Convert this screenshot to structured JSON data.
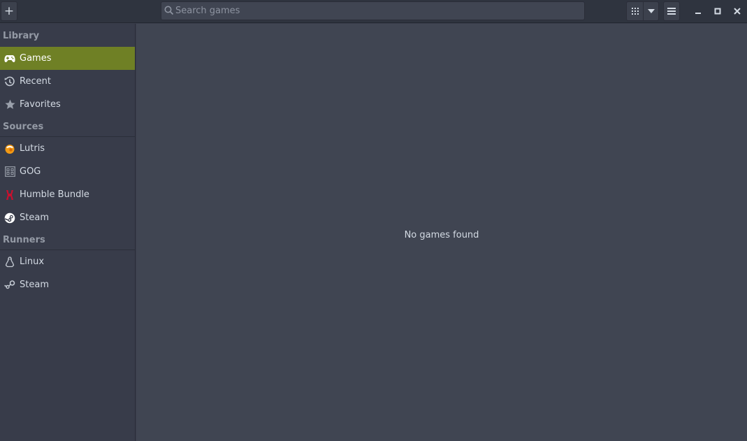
{
  "header": {
    "add_label": "+",
    "search_placeholder": "Search games",
    "search_value": "",
    "icons": {
      "add": "plus-icon",
      "search": "search-icon",
      "view": "grid-view-icon",
      "dropdown": "chevron-down-icon",
      "menu": "hamburger-menu-icon",
      "minimize": "minimize-icon",
      "maximize": "maximize-icon",
      "close": "close-icon"
    }
  },
  "sidebar": {
    "library_title": "Library",
    "library": [
      {
        "label": "Games",
        "icon": "gamepad-icon",
        "active": true
      },
      {
        "label": "Recent",
        "icon": "history-icon"
      },
      {
        "label": "Favorites",
        "icon": "star-icon"
      }
    ],
    "sources_title": "Sources",
    "sources": [
      {
        "label": "Lutris",
        "icon": "lutris-icon"
      },
      {
        "label": "GOG",
        "icon": "gog-icon"
      },
      {
        "label": "Humble Bundle",
        "icon": "humble-bundle-icon"
      },
      {
        "label": "Steam",
        "icon": "steam-icon"
      }
    ],
    "runners_title": "Runners",
    "runners": [
      {
        "label": "Linux",
        "icon": "linux-icon"
      },
      {
        "label": "Steam",
        "icon": "steam-runner-icon"
      }
    ]
  },
  "main": {
    "empty_message": "No games found"
  },
  "colors": {
    "accent": "#6f8025",
    "background": "#404552",
    "sidebar": "#383c4a",
    "headerbar": "#2f343f"
  }
}
